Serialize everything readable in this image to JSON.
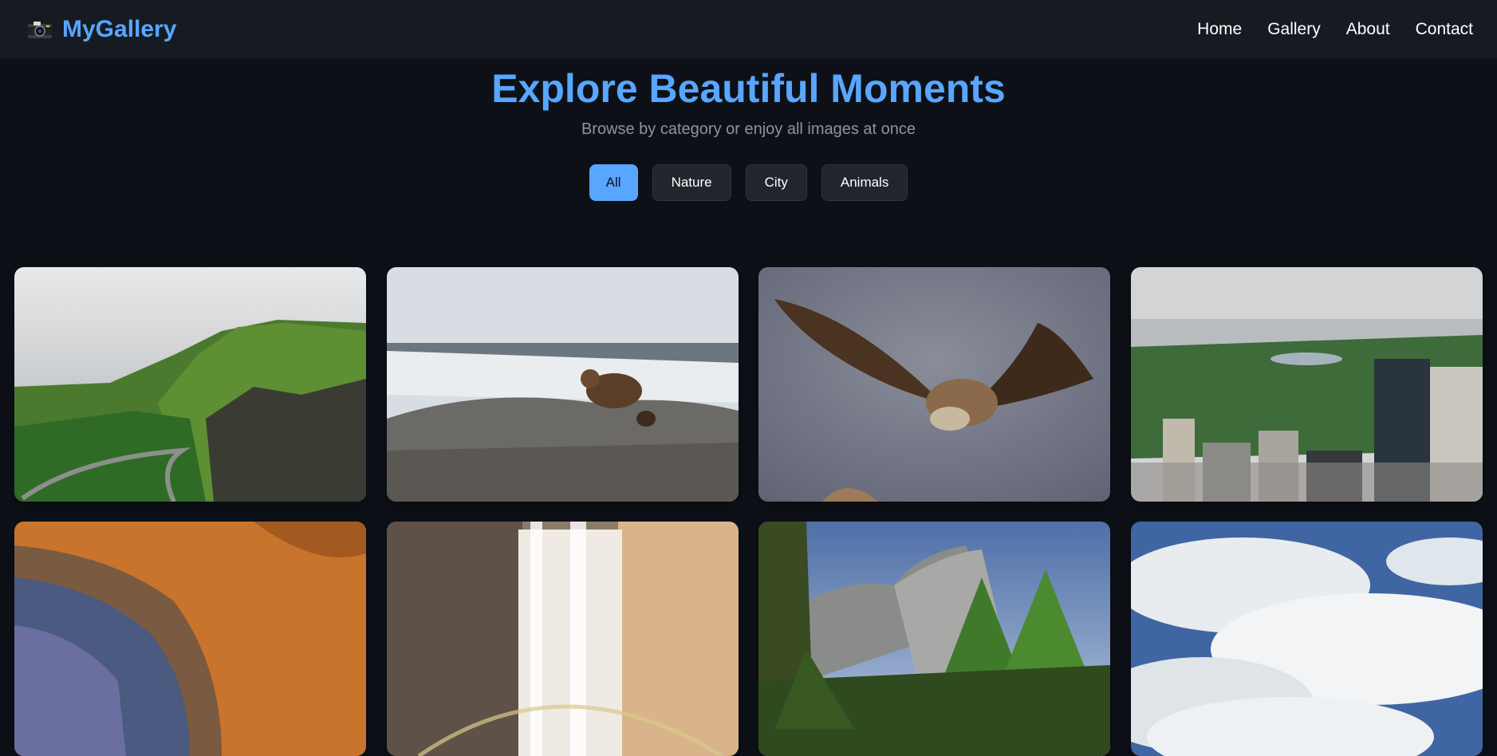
{
  "brand": {
    "icon": "camera-icon",
    "name": "MyGallery"
  },
  "nav": {
    "links": [
      "Home",
      "Gallery",
      "About",
      "Contact"
    ]
  },
  "hero": {
    "title": "Explore Beautiful Moments",
    "subtitle": "Browse by category or enjoy all images at once"
  },
  "filters": {
    "buttons": [
      "All",
      "Nature",
      "City",
      "Animals"
    ],
    "active": "All"
  },
  "colors": {
    "accent": "#58a6ff",
    "background": "#0d1117",
    "navbar": "#161b22"
  },
  "gallery": {
    "images": [
      {
        "subject": "green mountain cliffs with winding road",
        "category": "Nature"
      },
      {
        "subject": "brown bear on rocky snowy hillside",
        "category": "Animals"
      },
      {
        "subject": "vulture with spread wings in flight",
        "category": "Animals"
      },
      {
        "subject": "aerial view of city park and skyscrapers",
        "category": "City"
      },
      {
        "subject": "orange and blue crater landscape",
        "category": "Nature"
      },
      {
        "subject": "waterfall with rainbow mist",
        "category": "Nature"
      },
      {
        "subject": "granite cliffs behind pine forest",
        "category": "Nature"
      },
      {
        "subject": "white clouds in blue sky",
        "category": "Nature"
      }
    ]
  }
}
